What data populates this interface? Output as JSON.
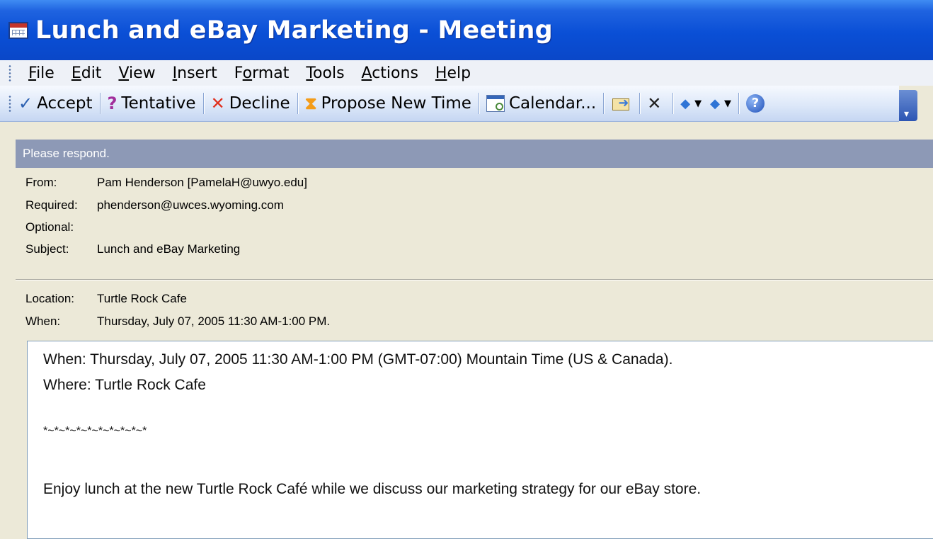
{
  "window": {
    "title": "Lunch and eBay Marketing - Meeting"
  },
  "menu": [
    {
      "label": "File",
      "key": "F"
    },
    {
      "label": "Edit",
      "key": "E"
    },
    {
      "label": "View",
      "key": "V"
    },
    {
      "label": "Insert",
      "key": "I"
    },
    {
      "label": "Format",
      "key": "o"
    },
    {
      "label": "Tools",
      "key": "T"
    },
    {
      "label": "Actions",
      "key": "A"
    },
    {
      "label": "Help",
      "key": "H"
    }
  ],
  "toolbar": {
    "accept": "Accept",
    "tentative": "Tentative",
    "decline": "Decline",
    "propose": "Propose New Time",
    "calendar": "Calendar..."
  },
  "infobar": {
    "text": "Please respond."
  },
  "header": {
    "from_label": "From:",
    "from_value": "Pam Henderson [PamelaH@uwyo.edu]",
    "required_label": "Required:",
    "required_value": "phenderson@uwces.wyoming.com",
    "optional_label": "Optional:",
    "optional_value": "",
    "subject_label": "Subject:",
    "subject_value": "Lunch and eBay Marketing",
    "location_label": "Location:",
    "location_value": "Turtle Rock Cafe",
    "when_label": "When:",
    "when_value": "Thursday, July 07, 2005 11:30 AM-1:00 PM."
  },
  "body": {
    "line1": "When: Thursday, July 07, 2005 11:30 AM-1:00 PM (GMT-07:00) Mountain Time (US & Canada).",
    "line2": "Where: Turtle Rock Cafe",
    "line3": "*~*~*~*~*~*~*~*~*~*",
    "line4": "Enjoy lunch at the new Turtle Rock Café while we discuss our marketing strategy for our eBay store."
  }
}
